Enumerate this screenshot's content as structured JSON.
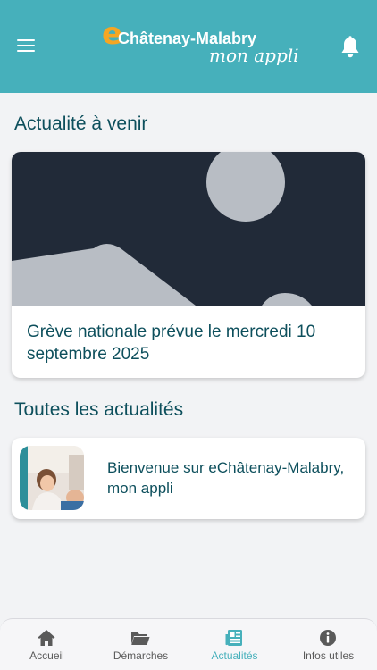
{
  "header": {
    "logo_e": "e",
    "logo_name": "Châtenay-Malabry",
    "logo_sub": "mon appli",
    "menu_icon": "hamburger-icon",
    "bell_icon": "bell-icon"
  },
  "upcoming": {
    "title": "Actualité à venir",
    "card_title": "Grève nationale prévue le mercredi 10 septembre 2025",
    "image_icon": "image-placeholder-icon"
  },
  "all_news": {
    "title": "Toutes les actualités",
    "items": [
      {
        "title": "Bienvenue sur eChâtenay-Malabry, mon appli"
      }
    ]
  },
  "tabs": [
    {
      "label": "Accueil",
      "icon": "home-icon",
      "active": false
    },
    {
      "label": "Démarches",
      "icon": "folder-icon",
      "active": false
    },
    {
      "label": "Actualités",
      "icon": "newspaper-icon",
      "active": true
    },
    {
      "label": "Infos utiles",
      "icon": "info-icon",
      "active": false
    }
  ],
  "colors": {
    "header": "#46b0bb",
    "accent": "#46b0bb",
    "title_text": "#0d4f5c",
    "logo_e": "#f5a623",
    "placeholder_bg": "#212a38"
  }
}
